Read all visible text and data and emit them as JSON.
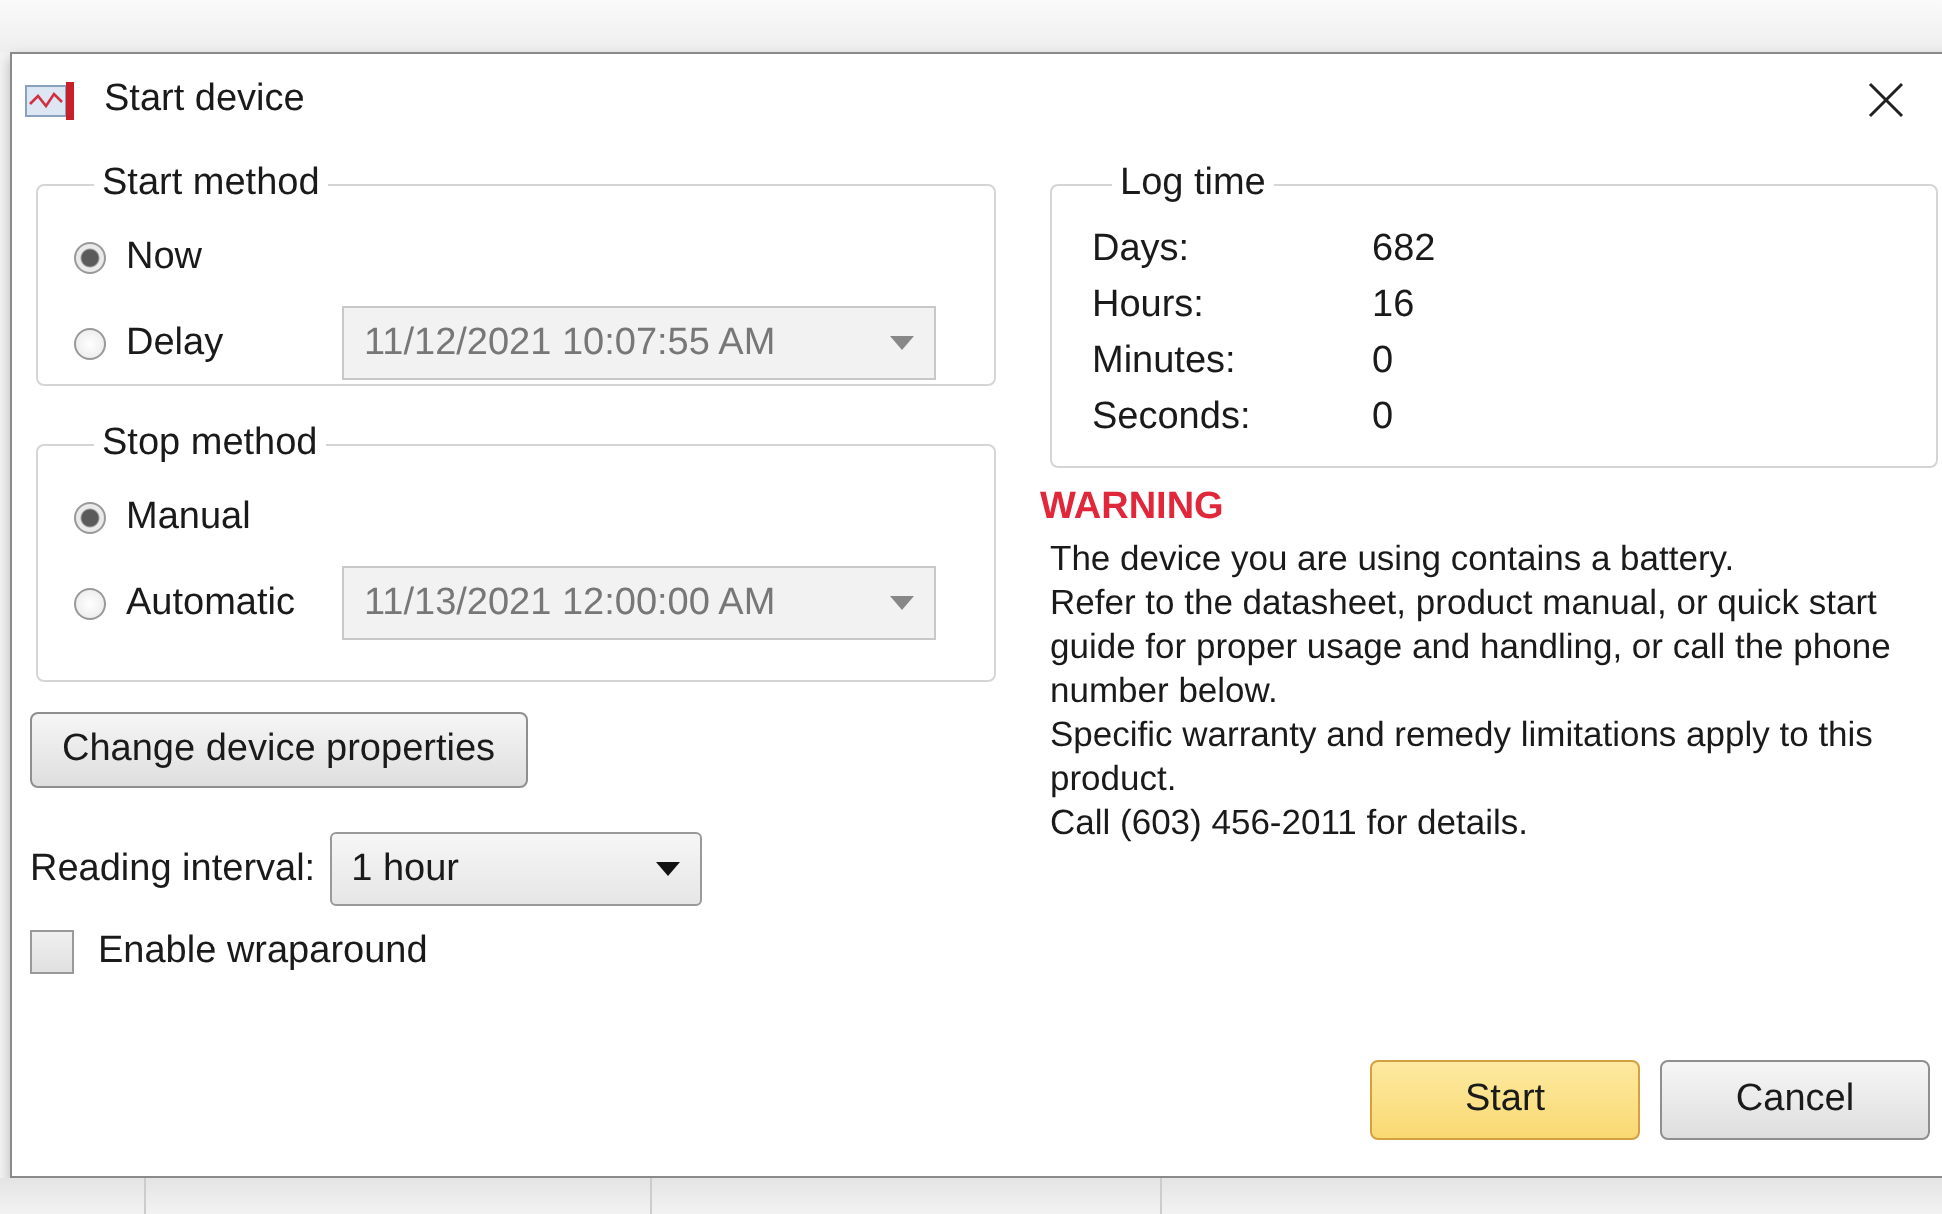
{
  "window": {
    "title": "Start device"
  },
  "start_method": {
    "title": "Start method",
    "options": [
      {
        "label": "Now",
        "selected": true
      },
      {
        "label": "Delay",
        "selected": false,
        "field": {
          "value": "11/12/2021 10:07:55 AM",
          "disabled": true
        }
      }
    ]
  },
  "stop_method": {
    "title": "Stop method",
    "options": [
      {
        "label": "Manual",
        "selected": true
      },
      {
        "label": "Automatic",
        "selected": false,
        "field": {
          "value": "11/13/2021 12:00:00 AM",
          "disabled": true
        }
      }
    ]
  },
  "change_button": "Change device properties",
  "reading_interval": {
    "label": "Reading interval:",
    "value": "1 hour"
  },
  "wraparound": {
    "label": "Enable wraparound",
    "checked": false
  },
  "log_time": {
    "title": "Log time",
    "rows": [
      {
        "label": "Days:",
        "value": "682"
      },
      {
        "label": "Hours:",
        "value": "16"
      },
      {
        "label": "Minutes:",
        "value": "0"
      },
      {
        "label": "Seconds:",
        "value": "0"
      }
    ]
  },
  "warning": {
    "title": "WARNING",
    "paragraphs": [
      "The device you are using contains a battery.",
      "Refer to the datasheet, product manual, or quick start guide for proper usage and handling, or call the phone number below.",
      "Specific warranty and remedy limitations apply to this product.",
      "Call (603) 456-2011 for details."
    ]
  },
  "buttons": [
    {
      "label": "Start",
      "default": true
    },
    {
      "label": "Cancel",
      "default": false
    }
  ]
}
